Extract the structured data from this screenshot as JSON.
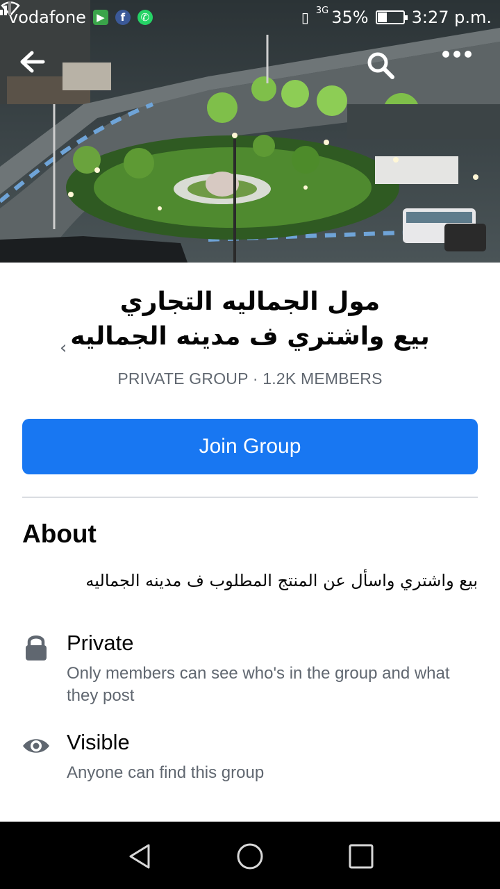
{
  "status_bar": {
    "carrier": "vodafone",
    "network": "3G",
    "battery_percent": "35%",
    "battery_level": 0.35,
    "time": "3:27 p.m."
  },
  "top_nav": {
    "back_icon": "arrow-left-icon",
    "search_icon": "search-icon",
    "more_icon": "more-dots-icon"
  },
  "group": {
    "name_line1": "مول الجماليه التجاري",
    "name_line2": "بيع واشتري ف مدينه الجماليه",
    "chevron": "›",
    "meta": "PRIVATE GROUP · 1.2K MEMBERS",
    "join_label": "Join Group"
  },
  "about": {
    "heading": "About",
    "description": "بيع واشتري واسأل عن المنتج المطلوب ف مدينه الجماليه",
    "features": [
      {
        "icon": "lock-icon",
        "title": "Private",
        "subtitle": "Only members can see who's in the group and what they post"
      },
      {
        "icon": "eye-icon",
        "title": "Visible",
        "subtitle": "Anyone can find this group"
      }
    ]
  },
  "colors": {
    "accent": "#1877f2",
    "secondary_text": "#606770",
    "divider": "#dadde1"
  }
}
